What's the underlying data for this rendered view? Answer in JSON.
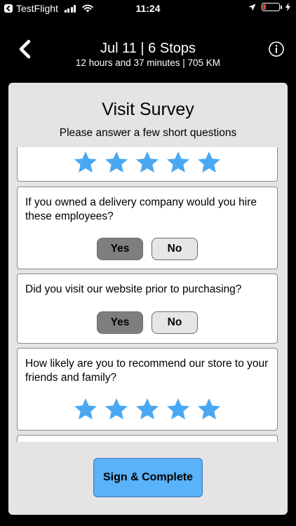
{
  "status_bar": {
    "back_app": "TestFlight",
    "time": "11:24",
    "battery_level": 0.2,
    "battery_color": "#ff3b30"
  },
  "header": {
    "title": "Jul 11 | 6 Stops",
    "subtitle": "12 hours and 37 minutes | 705 KM",
    "back_icon": "chevron-left-icon",
    "info_icon": "info-circle-icon"
  },
  "survey": {
    "title": "Visit Survey",
    "subtitle": "Please answer a few short questions",
    "star_color": "#4aa8f2",
    "questions": [
      {
        "text": "",
        "type": "rating",
        "rating": 5,
        "max": 5
      },
      {
        "text": "If you owned a delivery company would you hire these employees?",
        "type": "yes_no",
        "yes_label": "Yes",
        "no_label": "No",
        "selected": "Yes"
      },
      {
        "text": "Did you visit our website prior to purchasing?",
        "type": "yes_no",
        "yes_label": "Yes",
        "no_label": "No",
        "selected": "Yes"
      },
      {
        "text": "How likely are you to recommend our store to your friends and family?",
        "type": "rating",
        "rating": 5,
        "max": 5
      }
    ],
    "complete_button": "Sign & Complete",
    "accent_color": "#5ab2f8"
  }
}
